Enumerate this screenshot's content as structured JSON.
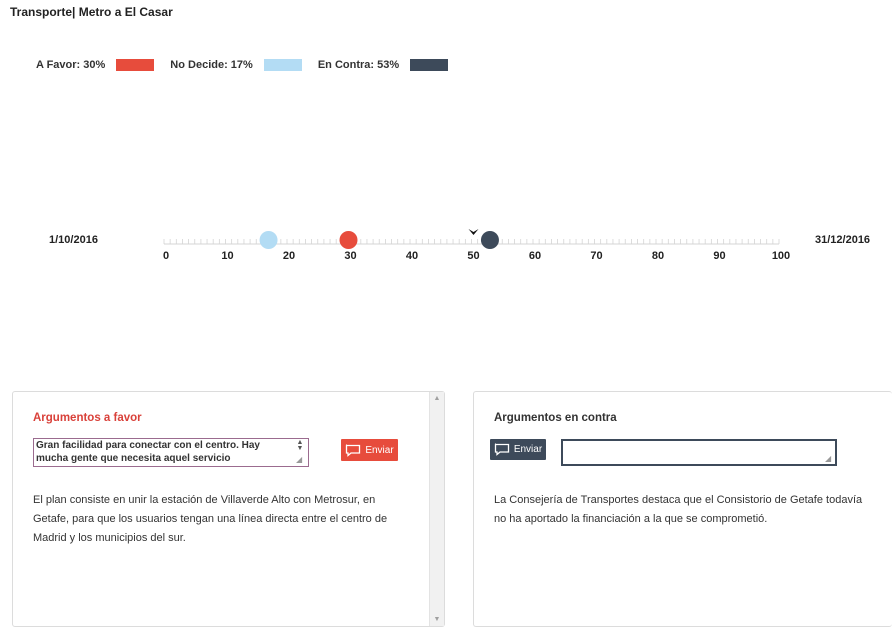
{
  "header": {
    "title": "Transporte| Metro a El Casar"
  },
  "legend": [
    {
      "label": "A Favor: 30%",
      "value": 30,
      "color": "#e74c3c"
    },
    {
      "label": "No Decide: 17%",
      "value": 17,
      "color": "#b3dcf4"
    },
    {
      "label": "En Contra: 53%",
      "value": 53,
      "color": "#3d4a5a"
    }
  ],
  "timeline": {
    "start_date": "1/10/2016",
    "end_date": "31/12/2016",
    "ticks": [
      "0",
      "10",
      "20",
      "30",
      "40",
      "50",
      "60",
      "70",
      "80",
      "90",
      "100"
    ],
    "range": [
      0,
      100
    ],
    "marker_value": 50,
    "points": [
      {
        "name": "No Decide",
        "value": 17,
        "color": "#b3dcf4"
      },
      {
        "name": "A Favor",
        "value": 30,
        "color": "#e74c3c"
      },
      {
        "name": "En Contra",
        "value": 53,
        "color": "#3d4a5a"
      }
    ]
  },
  "favor_panel": {
    "title": "Argumentos a favor",
    "title_color": "#d9413a",
    "input_value": "Gran facilidad para conectar con el centro. Hay mucha gente que necesita aquel servicio",
    "send_label": "Enviar",
    "send_color": "#e74c3c",
    "text": "El plan consiste en unir la estación de Villaverde Alto con Metrosur, en Getafe, para que los usuarios tengan una línea directa entre el centro de Madrid y los municipios del sur."
  },
  "contra_panel": {
    "title": "Argumentos en contra",
    "title_color": "#333333",
    "input_value": "",
    "send_label": "Enviar",
    "send_color": "#3d4a5a",
    "text": "La Consejería de Transportes destaca que el Consistorio de Getafe todavía no ha aportado la financiación a la que se comprometió."
  },
  "icons": {
    "send": "speech-bubble-icon",
    "marker": "chevron-down-icon",
    "scroll_up": "arrow-up-icon",
    "scroll_down": "arrow-down-icon"
  }
}
